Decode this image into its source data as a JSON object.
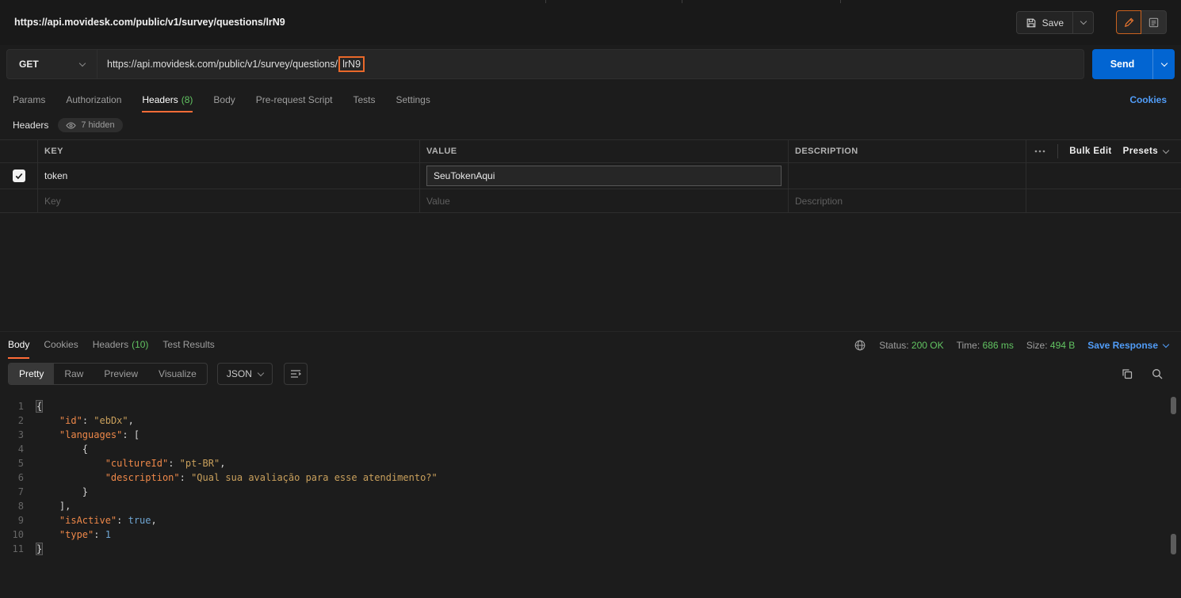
{
  "colors": {
    "accent_orange": "#ff6c37",
    "send_blue": "#0265d2",
    "success_green": "#62c462",
    "link_blue": "#519df8",
    "highlight_box_orange": "#e8682a"
  },
  "topbar": {
    "title": "https://api.movidesk.com/public/v1/survey/questions/lrN9",
    "save_label": "Save"
  },
  "request_bar": {
    "method": "GET",
    "url_base": "https://api.movidesk.com/public/v1/survey/questions/",
    "url_highlighted": "lrN9",
    "send_label": "Send"
  },
  "request_tabs": {
    "params": "Params",
    "authorization": "Authorization",
    "headers": "Headers",
    "headers_count": "(8)",
    "body": "Body",
    "prerequest": "Pre-request Script",
    "tests": "Tests",
    "settings": "Settings",
    "cookies_link": "Cookies"
  },
  "headers_panel": {
    "title": "Headers",
    "hidden_badge": "7 hidden",
    "col_key": "KEY",
    "col_value": "VALUE",
    "col_description": "DESCRIPTION",
    "bulk_edit": "Bulk Edit",
    "presets": "Presets",
    "row": {
      "key": "token",
      "value": "SeuTokenAqui"
    },
    "new_row_placeholders": {
      "key": "Key",
      "value": "Value",
      "description": "Description"
    }
  },
  "response_panel": {
    "tab_body": "Body",
    "tab_cookies": "Cookies",
    "tab_headers": "Headers",
    "tab_headers_count": "(10)",
    "tab_test_results": "Test Results",
    "status_label": "Status:",
    "status_value": "200 OK",
    "time_label": "Time:",
    "time_value": "686 ms",
    "size_label": "Size:",
    "size_value": "494 B",
    "save_response": "Save Response",
    "view_pretty": "Pretty",
    "view_raw": "Raw",
    "view_preview": "Preview",
    "view_visualize": "Visualize",
    "language": "JSON"
  },
  "response_body": {
    "lines": [
      {
        "num": "1",
        "tokens": [
          [
            "brace",
            "{"
          ]
        ]
      },
      {
        "num": "2",
        "tokens": [
          [
            "ws",
            "    "
          ],
          [
            "key",
            "\"id\""
          ],
          [
            "punc",
            ": "
          ],
          [
            "str",
            "\"ebDx\""
          ],
          [
            "punc",
            ","
          ]
        ]
      },
      {
        "num": "3",
        "tokens": [
          [
            "ws",
            "    "
          ],
          [
            "key",
            "\"languages\""
          ],
          [
            "punc",
            ": ["
          ]
        ]
      },
      {
        "num": "4",
        "tokens": [
          [
            "ws",
            "        "
          ],
          [
            "punc",
            "{"
          ]
        ]
      },
      {
        "num": "5",
        "tokens": [
          [
            "ws",
            "            "
          ],
          [
            "key",
            "\"cultureId\""
          ],
          [
            "punc",
            ": "
          ],
          [
            "str",
            "\"pt-BR\""
          ],
          [
            "punc",
            ","
          ]
        ]
      },
      {
        "num": "6",
        "tokens": [
          [
            "ws",
            "            "
          ],
          [
            "key",
            "\"description\""
          ],
          [
            "punc",
            ": "
          ],
          [
            "str",
            "\"Qual sua avaliação para esse atendimento?\""
          ]
        ]
      },
      {
        "num": "7",
        "tokens": [
          [
            "ws",
            "        "
          ],
          [
            "punc",
            "}"
          ]
        ]
      },
      {
        "num": "8",
        "tokens": [
          [
            "ws",
            "    "
          ],
          [
            "punc",
            "],"
          ]
        ]
      },
      {
        "num": "9",
        "tokens": [
          [
            "ws",
            "    "
          ],
          [
            "key",
            "\"isActive\""
          ],
          [
            "punc",
            ": "
          ],
          [
            "bool",
            "true"
          ],
          [
            "punc",
            ","
          ]
        ]
      },
      {
        "num": "10",
        "tokens": [
          [
            "ws",
            "    "
          ],
          [
            "key",
            "\"type\""
          ],
          [
            "punc",
            ": "
          ],
          [
            "num",
            "1"
          ]
        ]
      },
      {
        "num": "11",
        "tokens": [
          [
            "brace",
            "}"
          ]
        ]
      }
    ]
  }
}
